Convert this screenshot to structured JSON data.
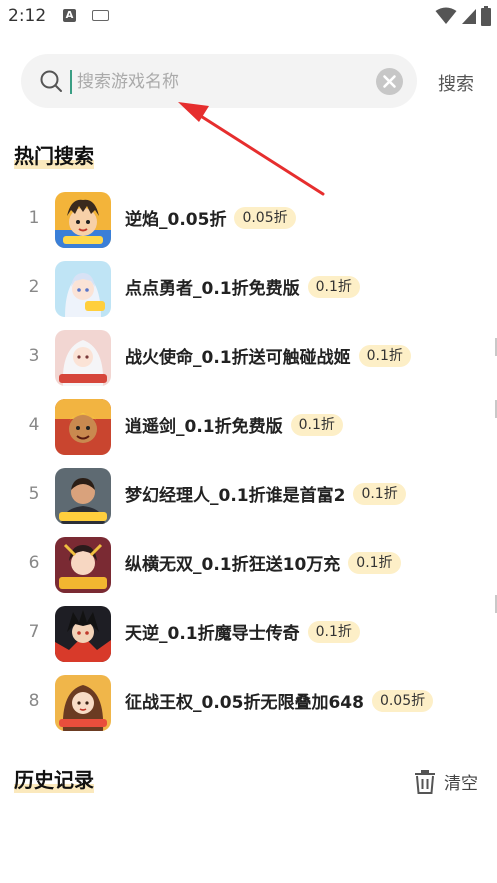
{
  "status_bar": {
    "time": "2:12",
    "a_label": "A"
  },
  "search": {
    "placeholder": "搜索游戏名称",
    "value": "",
    "button_label": "搜索"
  },
  "hot_section": {
    "title": "热门搜索",
    "items": [
      {
        "rank": "1",
        "name": "逆焰_0.05折",
        "discount": "0.05折",
        "icon": "hero-boy-icon"
      },
      {
        "rank": "2",
        "name": "点点勇者_0.1折免费版",
        "discount": "0.1折",
        "icon": "anime-girl-icon"
      },
      {
        "rank": "3",
        "name": "战火使命_0.1折送可触碰战姬",
        "discount": "0.1折",
        "icon": "warrior-girl-icon"
      },
      {
        "rank": "4",
        "name": "逍遥剑_0.1折免费版",
        "discount": "0.1折",
        "icon": "monkey-king-icon"
      },
      {
        "rank": "5",
        "name": "梦幻经理人_0.1折谁是首富2",
        "discount": "0.1折",
        "icon": "businessman-icon"
      },
      {
        "rank": "6",
        "name": "纵横无双_0.1折狂送10万充",
        "discount": "0.1折",
        "icon": "general-icon"
      },
      {
        "rank": "7",
        "name": "天逆_0.1折魔导士传奇",
        "discount": "0.1折",
        "icon": "dark-mage-icon"
      },
      {
        "rank": "8",
        "name": "征战王权_0.05折无限叠加648",
        "discount": "0.05折",
        "icon": "queen-icon"
      }
    ]
  },
  "history_section": {
    "title": "历史记录",
    "clear_label": "清空"
  },
  "colors": {
    "highlight": "#fbe9bd",
    "badge_bg": "#fdefc7",
    "caret": "#3a9e84",
    "arrow": "#e62e2e"
  }
}
